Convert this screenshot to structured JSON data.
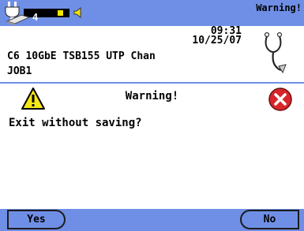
{
  "header": {
    "title": "Warning!",
    "time": "09:31",
    "date": "10/25/07",
    "count": "4",
    "battery_level": 0.55
  },
  "info": {
    "cable_line": "C6 10GbE TSB155 UTP Chan",
    "job_line": "JOB1"
  },
  "dialog": {
    "title": "Warning!",
    "message": "Exit without saving?"
  },
  "softkeys": {
    "yes_label": "Yes",
    "no_label": "No"
  },
  "colors": {
    "accent": "#6f8fe6",
    "warning": "#f5e61a",
    "error": "#d8262b"
  },
  "icons": [
    "power-plug-icon",
    "battery-icon",
    "speaker-icon",
    "cable-icon",
    "stethoscope-icon",
    "warning-icon",
    "error-x-icon"
  ]
}
